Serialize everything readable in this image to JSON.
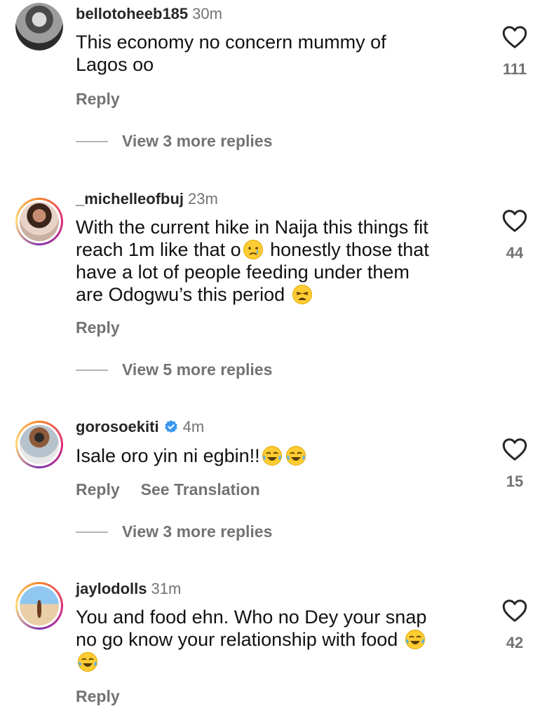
{
  "comments": [
    {
      "username": "bellotoheeb185",
      "time": "30m",
      "lines": [
        "This economy no concern mummy of",
        "Lagos oo"
      ],
      "reply_label": "Reply",
      "likes": "111",
      "view_more": "View 3 more replies"
    },
    {
      "username": "_michelleofbuj",
      "time": "23m",
      "lines": [
        "With the current hike in Naija this things fit",
        "reach 1m like that o",
        " honestly those that",
        "have a lot of people feeding under them",
        "are Odogwu’s this period "
      ],
      "reply_label": "Reply",
      "likes": "44",
      "view_more": "View 5 more replies"
    },
    {
      "username": "gorosoekiti",
      "time": "4m",
      "verified": true,
      "lines": [
        "Isale oro yin ni egbin!!"
      ],
      "reply_label": "Reply",
      "translate_label": "See Translation",
      "likes": "15",
      "view_more": "View 3 more replies"
    },
    {
      "username": "jaylodolls",
      "time": "31m",
      "lines": [
        "You and food ehn. Who no Dey your snap",
        "no go know your relationship with food "
      ],
      "reply_label": "Reply",
      "likes": "42"
    }
  ],
  "colors": {
    "secondary_text": "#737373",
    "verified_blue": "#3897f0",
    "emoji_yellow": "#ffcc33"
  },
  "icons": [
    "heart-icon",
    "verified-icon",
    "crying-face-emoji",
    "weary-face-emoji",
    "tears-of-joy-emoji"
  ]
}
